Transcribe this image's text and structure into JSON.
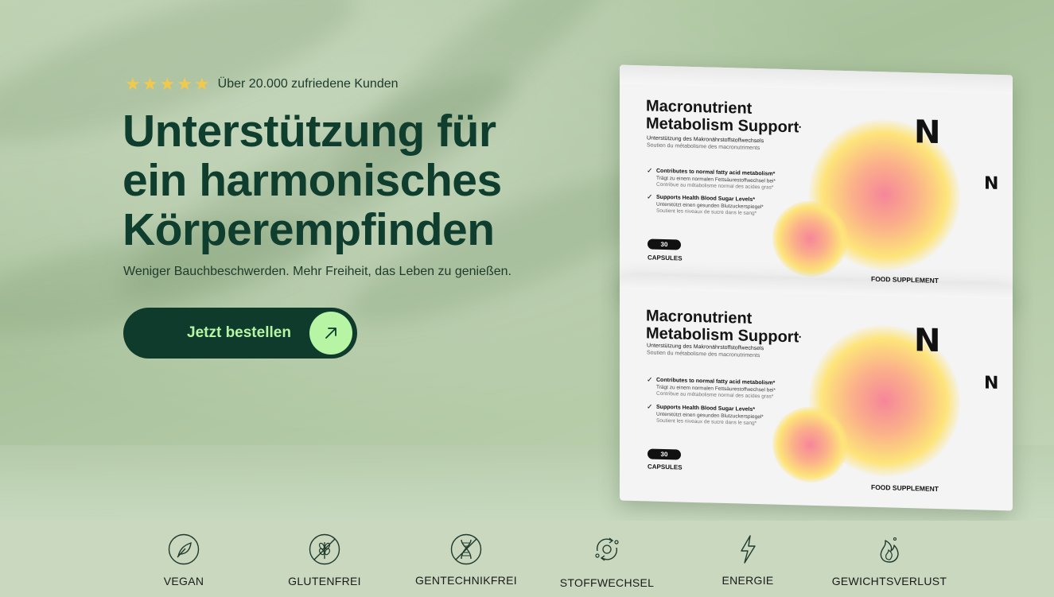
{
  "rating": {
    "stars": 5,
    "star_glyph": "★",
    "text": "Über 20.000 zufriedene Kunden"
  },
  "headline": {
    "line1": "Unterstützung für",
    "line2": "ein harmonisches",
    "line3": "Körperempfinden"
  },
  "subline": "Weniger Bauchbeschwerden. Mehr Freiheit, das Leben zu genießen.",
  "cta": {
    "label": "Jetzt bestellen",
    "icon": "arrow-up-right-icon"
  },
  "product": {
    "title_line1": "Macronutrient",
    "title_line2": "Metabolism Support",
    "trademark": "•",
    "subtitle_de": "Unterstützung des Makronährstoffstoffwechsels",
    "subtitle_fr": "Soutien du métabolisme des macronutriments",
    "claim1": "Contributes to normal fatty acid metabolism*",
    "claim1_de": "Trägt zu einem normalen Fettsäurestoffwechsel bei*",
    "claim1_fr": "Contribue au métabolisme normal des acides gras*",
    "claim2": "Supports Health Blood Sugar Levels*",
    "claim2_de": "Unterstützt einen gesunden Blutzuckerspiegel*",
    "claim2_fr": "Soutient les niveaux de sucre dans le sang*",
    "count": "30",
    "unit": "CAPSULES",
    "category": "FOOD SUPPLEMENT",
    "logo": "N"
  },
  "features": [
    {
      "label": "VEGAN",
      "icon": "vegan-leaf-icon"
    },
    {
      "label": "GLUTENFREI",
      "icon": "gluten-free-icon"
    },
    {
      "label": "GENTECHNIKFREI",
      "icon": "gmo-free-dna-icon"
    },
    {
      "label": "STOFFWECHSEL",
      "icon": "metabolism-cycle-icon"
    },
    {
      "label": "ENERGIE",
      "icon": "energy-bolt-icon"
    },
    {
      "label": "GEWICHTSVERLUST",
      "icon": "weight-loss-flame-icon"
    }
  ],
  "colors": {
    "accent": "#b7f5a5",
    "dark_green": "#0f3b2c",
    "star": "#f2c94c"
  }
}
